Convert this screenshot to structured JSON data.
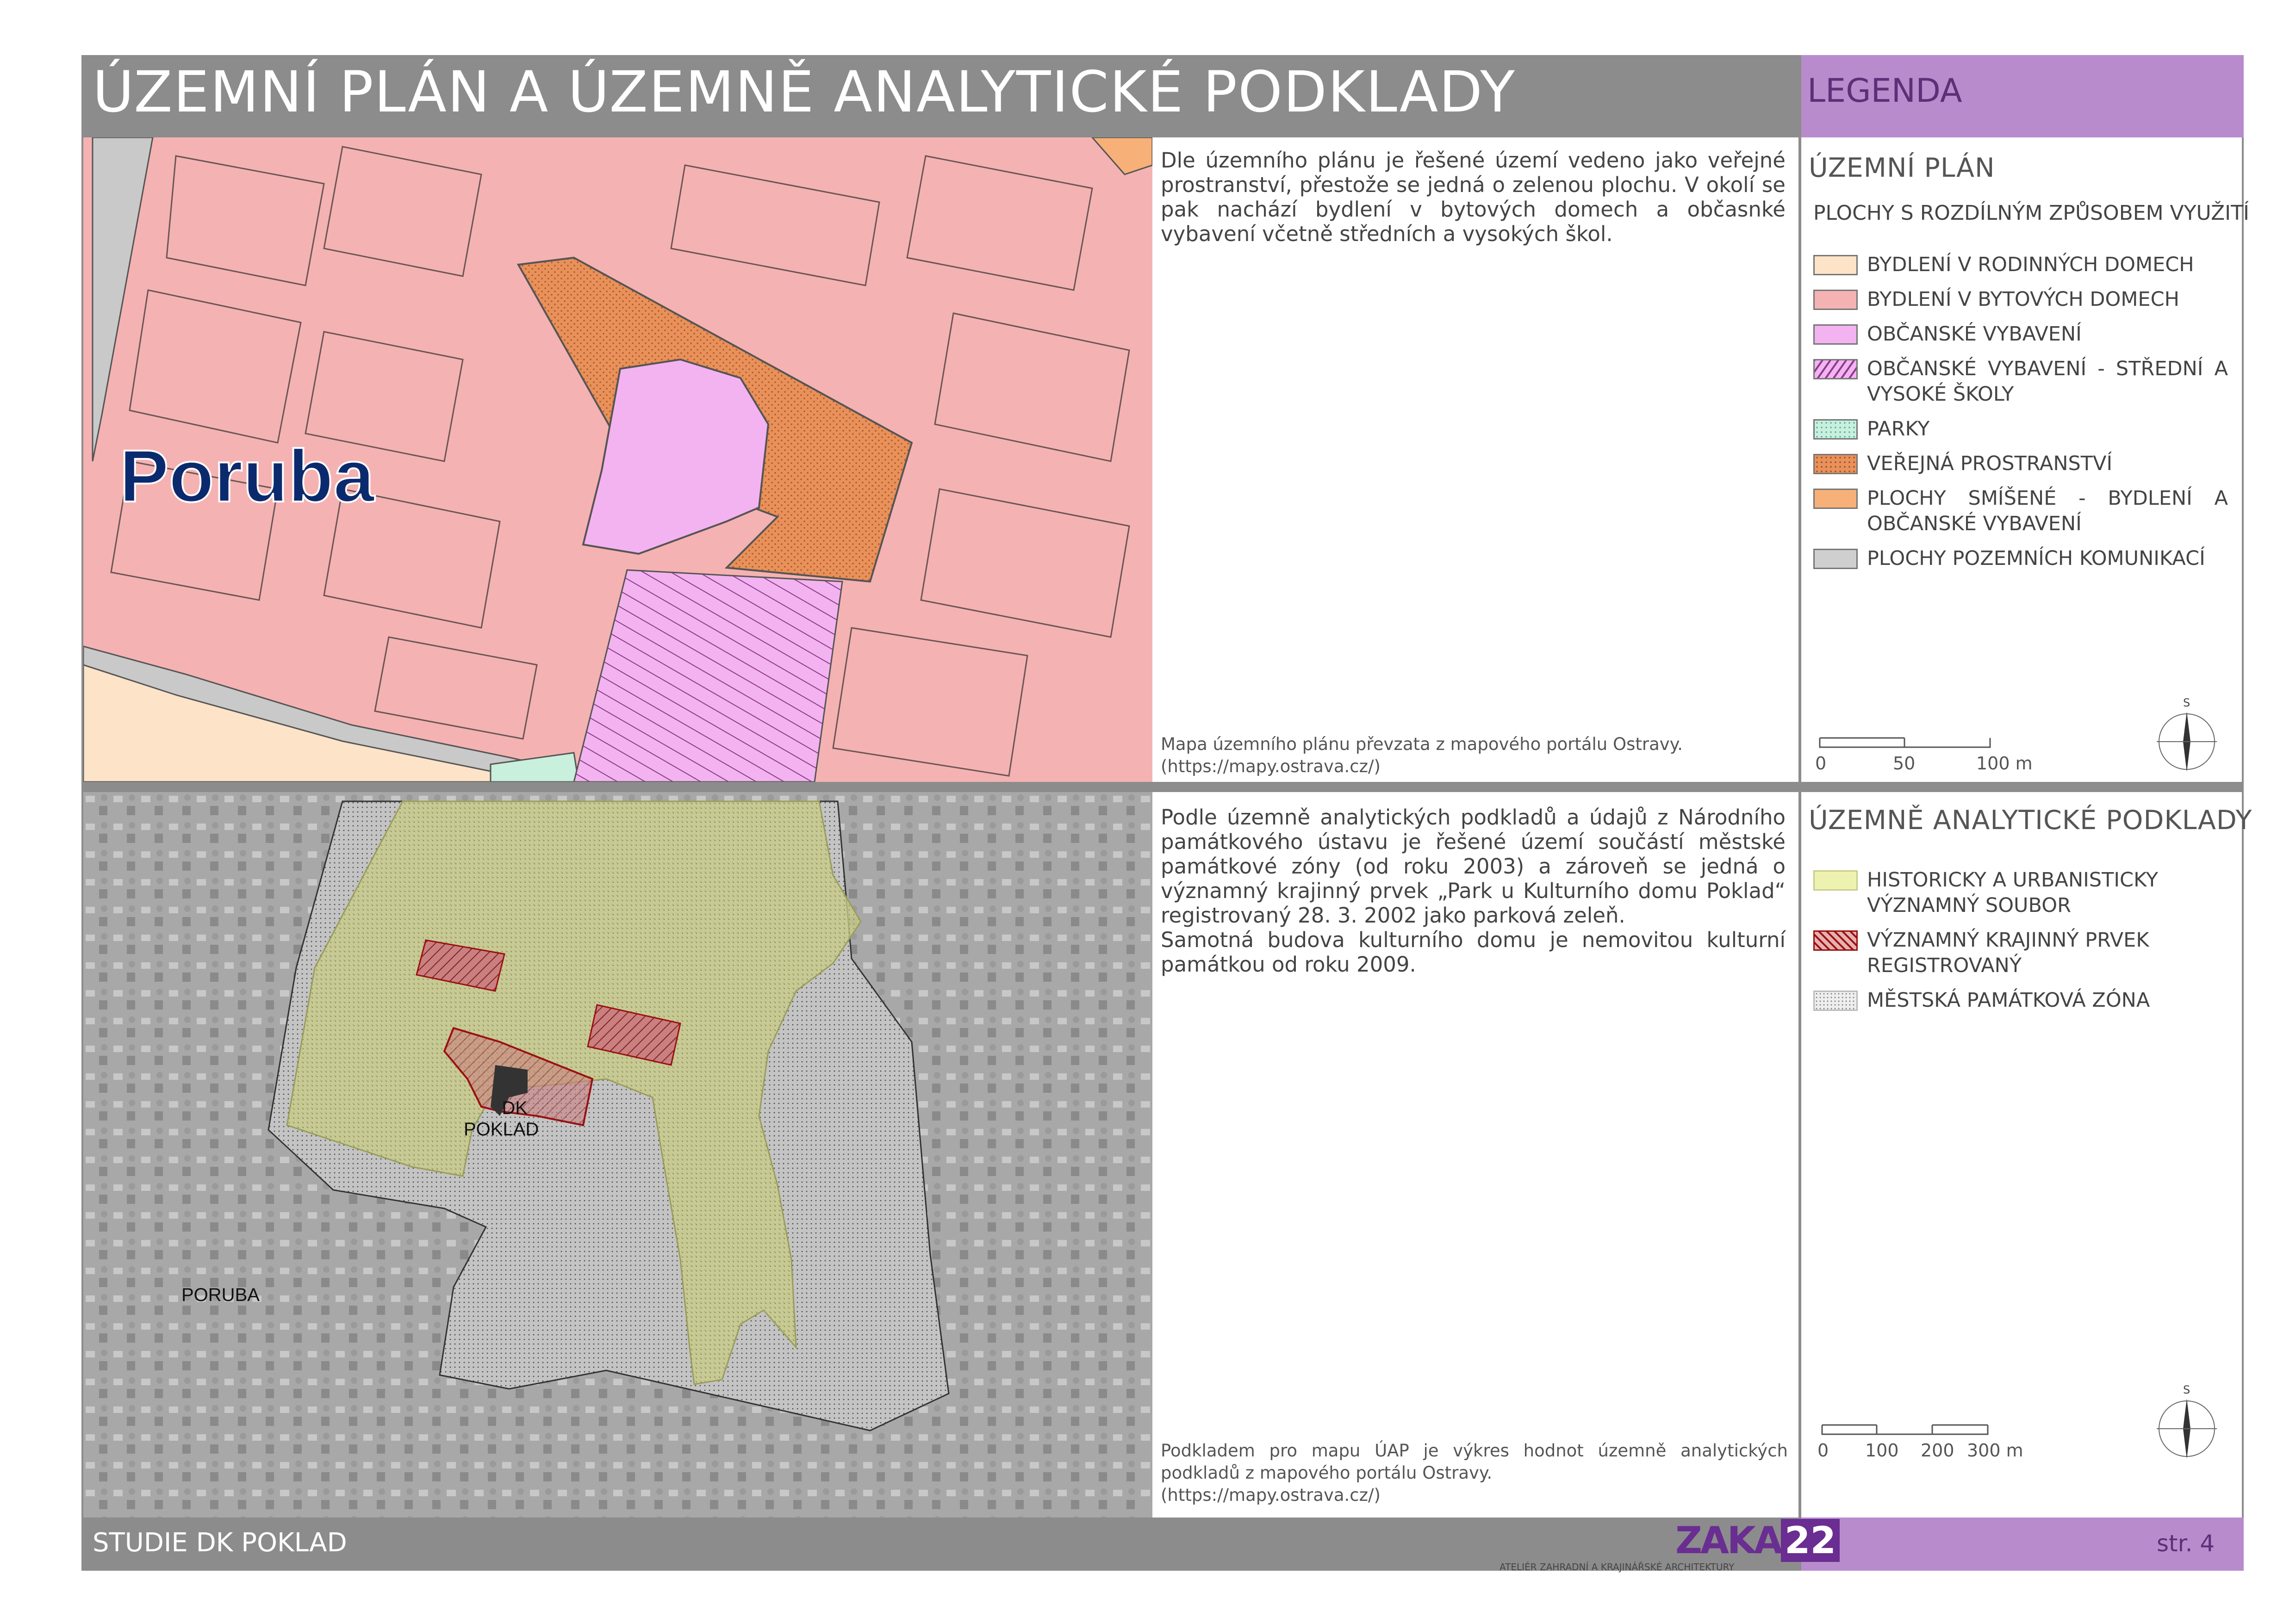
{
  "header": {
    "title": "ÚZEMNÍ PLÁN A ÚZEMNĚ ANALYTICKÉ PODKLADY",
    "legend_title": "LEGENDA"
  },
  "top": {
    "map_label": "Poruba",
    "text": "Dle územního plánu je řešené území vedeno jako veřejné prostranství, přestože se jedná o zelenou plochu. V okolí se pak nachází bydlení v bytových domech a občasnké vybavení včetně středních a vysokých škol.",
    "source": "Mapa územního plánu převzata z mapového portálu Ostravy.",
    "source_url": "(https://mapy.ostrava.cz/)",
    "legend": {
      "title": "ÚZEMNÍ PLÁN",
      "subtitle": "PLOCHY S ROZDÍLNÝM ZPŮSOBEM VYUŽITÍ",
      "items": [
        {
          "label": "BYDLENÍ V RODINNÝCH DOMECH",
          "color": "#fde3c8"
        },
        {
          "label": "BYDLENÍ V BYTOVÝCH DOMECH",
          "color": "#f5b2b2"
        },
        {
          "label": "OBČANSKÉ VYBAVENÍ",
          "color": "#f3b3f0"
        },
        {
          "label": "OBČANSKÉ VYBAVENÍ - STŘEDNÍ A VYSOKÉ ŠKOLY",
          "color": "#f3b3f0"
        },
        {
          "label": "PARKY",
          "color": "#c8f0dc"
        },
        {
          "label": "VEŘEJNÁ PROSTRANSTVÍ",
          "color": "#e8915a"
        },
        {
          "label": "PLOCHY SMÍŠENÉ - BYDLENÍ A OBČANSKÉ VYBAVENÍ",
          "color": "#f7b078"
        },
        {
          "label": "PLOCHY POZEMNÍCH KOMUNIKACÍ",
          "color": "#cfcfcf"
        }
      ],
      "scale": [
        "0",
        "50",
        "100 m"
      ],
      "north": "S"
    }
  },
  "bottom": {
    "map_label_dk": "DK",
    "map_label_poklad": "POKLAD",
    "map_label_poruba": "PORUBA",
    "text1": "Podle územně analytických podkladů a údajů z Národního památkového ústavu je řešené území součástí městské památkové zóny (od roku 2003) a zároveň se jedná o významný krajinný prvek „Park u Kulturního domu Poklad“ registrovaný 28. 3. 2002 jako parková zeleň.",
    "text2": "Samotná budova kulturního domu je nemovitou kulturní památkou od roku 2009.",
    "source": "Podkladem pro mapu ÚAP je výkres hodnot územně analytických podkladů z mapového portálu Ostravy.",
    "source_url": "(https://mapy.ostrava.cz/)",
    "legend": {
      "title": "ÚZEMNĚ ANALYTICKÉ PODKLADY",
      "items": [
        {
          "label": "HISTORICKY A URBANISTICKY VÝZNAMNÝ SOUBOR",
          "color": "#eef2b0"
        },
        {
          "label": "VÝZNAMNÝ KRAJINNÝ PRVEK REGISTROVANÝ",
          "color": "#e6b0b0"
        },
        {
          "label": "MĚSTSKÁ PAMÁTKOVÁ ZÓNA",
          "color": "#eeeeee"
        }
      ],
      "scale": [
        "0",
        "100",
        "200",
        "300 m"
      ],
      "north": "S"
    }
  },
  "footer": {
    "title": "STUDIE DK POKLAD",
    "logo": "ZAKA",
    "logo_num": "22",
    "logo_sub": "ATELIÉR ZAHRADNÍ A KRAJINÁŘSKÉ ARCHITEKTURY",
    "page": "str. 4"
  }
}
